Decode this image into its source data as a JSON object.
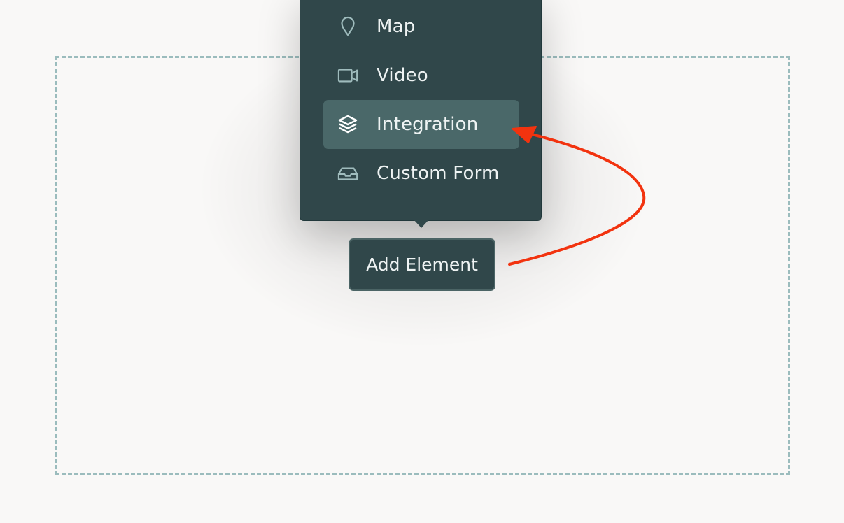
{
  "menu": {
    "items": [
      {
        "label": "Map",
        "icon": "map-pin-icon"
      },
      {
        "label": "Video",
        "icon": "video-camera-icon"
      },
      {
        "label": "Integration",
        "icon": "layers-icon",
        "active": true
      },
      {
        "label": "Custom Form",
        "icon": "inbox-tray-icon"
      }
    ]
  },
  "add_element": {
    "label": "Add Element"
  },
  "colors": {
    "menu_bg": "#30474a",
    "active_item_bg": "#4a6869",
    "icon_stroke": "#9fbcbd",
    "dropzone_border": "#9bbcbd",
    "annotation_arrow": "#f2330f"
  }
}
